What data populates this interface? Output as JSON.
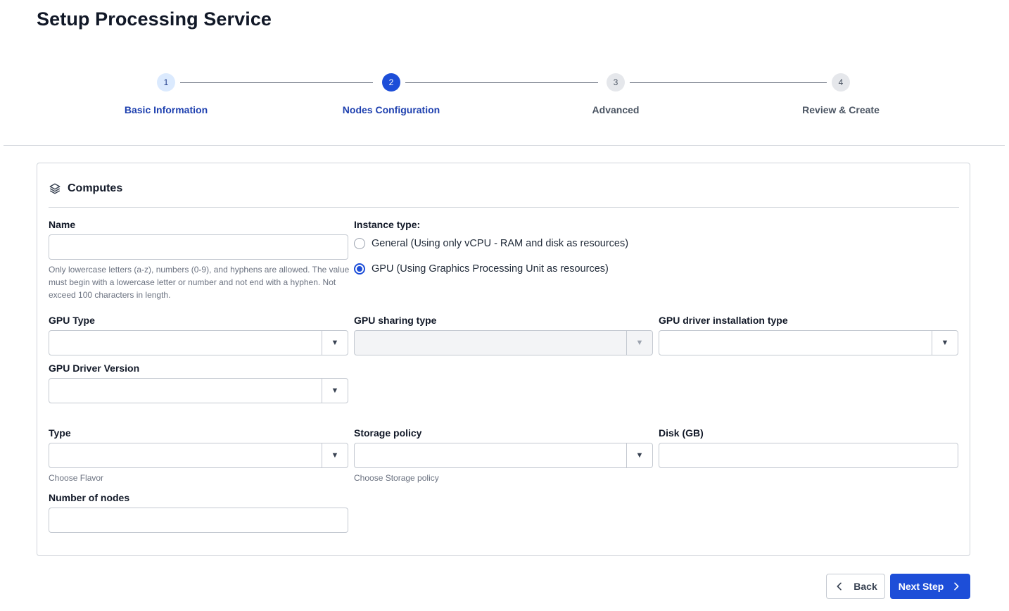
{
  "page": {
    "title": "Setup Processing Service"
  },
  "stepper": {
    "steps": [
      {
        "number": "1",
        "label": "Basic Information",
        "state": "completed"
      },
      {
        "number": "2",
        "label": "Nodes Configuration",
        "state": "active"
      },
      {
        "number": "3",
        "label": "Advanced",
        "state": "pending"
      },
      {
        "number": "4",
        "label": "Review & Create",
        "state": "pending"
      }
    ]
  },
  "computes": {
    "icon": "layers-icon",
    "title": "Computes",
    "name": {
      "label": "Name",
      "value": "",
      "help": "Only lowercase letters (a-z), numbers (0-9), and hyphens are allowed. The value must begin with a lowercase letter or number and not end with a hyphen. Not exceed 100 characters in length."
    },
    "instance_type": {
      "label": "Instance type:",
      "options": [
        {
          "label": "General (Using only vCPU - RAM and disk as resources)",
          "checked": false
        },
        {
          "label": "GPU (Using Graphics Processing Unit as resources)",
          "checked": true
        }
      ]
    },
    "gpu_type": {
      "label": "GPU Type",
      "value": ""
    },
    "gpu_sharing_type": {
      "label": "GPU sharing type",
      "value": "",
      "disabled": true
    },
    "gpu_driver_installation_type": {
      "label": "GPU driver installation type",
      "value": ""
    },
    "gpu_driver_version": {
      "label": "GPU Driver Version",
      "value": ""
    },
    "type": {
      "label": "Type",
      "value": "",
      "help": "Choose Flavor"
    },
    "storage_policy": {
      "label": "Storage policy",
      "value": "",
      "help": "Choose Storage policy"
    },
    "disk": {
      "label": "Disk (GB)",
      "value": ""
    },
    "number_of_nodes": {
      "label": "Number of nodes",
      "value": ""
    }
  },
  "actions": {
    "back_label": "Back",
    "next_label": "Next Step"
  },
  "colors": {
    "primary": "#1d4ed8",
    "step_done_bg": "#dbeafe",
    "border": "#c4c9d1"
  }
}
